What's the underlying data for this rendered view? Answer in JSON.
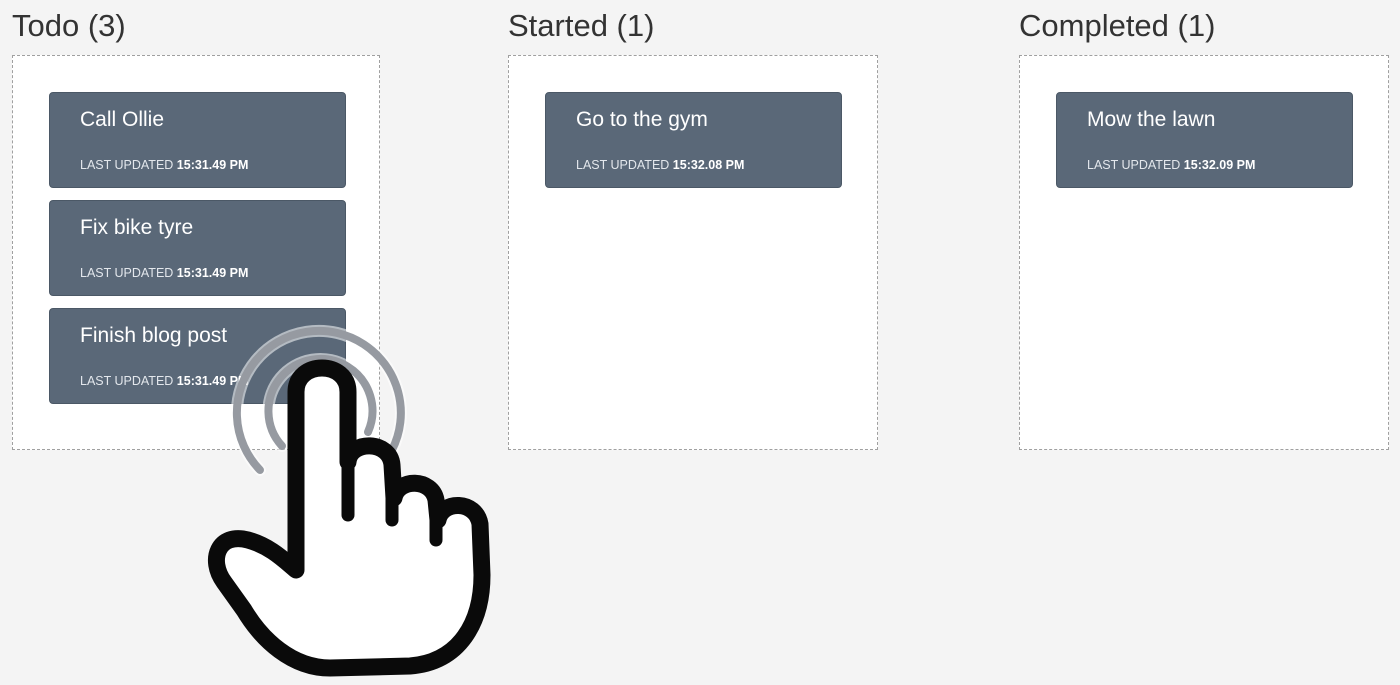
{
  "board": {
    "columns": [
      {
        "title": "Todo (3)",
        "cards": [
          {
            "title": "Call Ollie",
            "updated_label": "LAST UPDATED",
            "updated_time": "15:31.49 PM"
          },
          {
            "title": "Fix bike tyre",
            "updated_label": "LAST UPDATED",
            "updated_time": "15:31.49 PM"
          },
          {
            "title": "Finish blog post",
            "updated_label": "LAST UPDATED",
            "updated_time": "15:31.49 PM"
          }
        ]
      },
      {
        "title": "Started (1)",
        "cards": [
          {
            "title": "Go to the gym",
            "updated_label": "LAST UPDATED",
            "updated_time": "15:32.08 PM"
          }
        ]
      },
      {
        "title": "Completed (1)",
        "cards": [
          {
            "title": "Mow the lawn",
            "updated_label": "LAST UPDATED",
            "updated_time": "15:32.09 PM"
          }
        ]
      }
    ]
  },
  "colors": {
    "page_background": "#f4f4f4",
    "card_background": "#5a6878",
    "column_border": "#a0a0a0"
  },
  "overlay": {
    "icon": "tap-gesture-hand-icon"
  }
}
